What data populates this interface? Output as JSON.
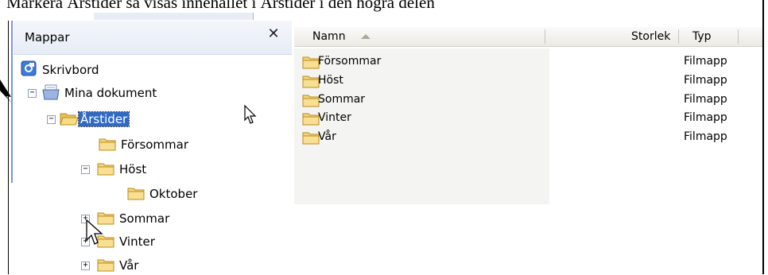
{
  "caption": "Markera Årstider så visas innehållet i Årstider i den högra delen",
  "folders_pane": {
    "title": "Mappar",
    "close_label": "✕",
    "tree": [
      {
        "label": "Skrivbord",
        "toggle": "",
        "icon": "desktop-icon"
      },
      {
        "label": "Mina dokument",
        "toggle": "−",
        "icon": "documents-icon"
      },
      {
        "label": "Årstider",
        "toggle": "−",
        "icon": "folder-open-icon",
        "selected": true
      },
      {
        "label": "Försommar",
        "toggle": "",
        "icon": "folder-icon"
      },
      {
        "label": "Höst",
        "toggle": "−",
        "icon": "folder-icon"
      },
      {
        "label": "Oktober",
        "toggle": "",
        "icon": "folder-icon"
      },
      {
        "label": "Sommar",
        "toggle": "+",
        "icon": "folder-icon"
      },
      {
        "label": "Vinter",
        "toggle": "+",
        "icon": "folder-icon"
      },
      {
        "label": "Vår",
        "toggle": "+",
        "icon": "folder-icon"
      }
    ]
  },
  "details_pane": {
    "columns": {
      "name": "Namn",
      "size": "Storlek",
      "type": "Typ"
    },
    "sort_icon": "sort-ascending-icon",
    "files": [
      {
        "name": "Försommar",
        "type": "Filmapp"
      },
      {
        "name": "Höst",
        "type": "Filmapp"
      },
      {
        "name": "Sommar",
        "type": "Filmapp"
      },
      {
        "name": "Vinter",
        "type": "Filmapp"
      },
      {
        "name": "Vår",
        "type": "Filmapp"
      }
    ]
  },
  "colors": {
    "selection": "#316ac5",
    "folder_fill": "#f5d479",
    "folder_stroke": "#b98c1d",
    "pane_header": "#e7ecf6",
    "accent_line": "#7a96df"
  }
}
